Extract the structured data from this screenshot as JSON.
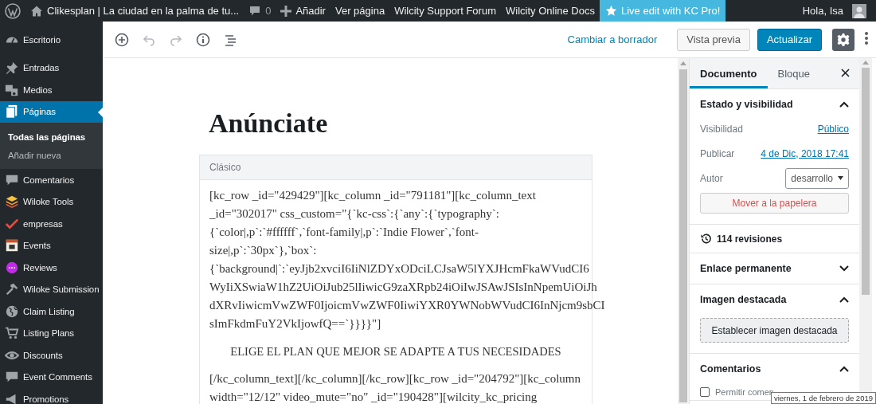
{
  "admin_bar": {
    "site_title": "Clikesplan | La ciudad en la palma de tu...",
    "comments_count": "0",
    "items": [
      {
        "label": "Añadir",
        "kind": "new"
      },
      {
        "label": "Ver página",
        "kind": "link"
      },
      {
        "label": "Wilcity Support Forum",
        "kind": "link"
      },
      {
        "label": "Wilcity Online Docs",
        "kind": "link"
      },
      {
        "label": "Live edit with KC Pro!",
        "kind": "highlight"
      }
    ],
    "greeting": "Hola, Isa"
  },
  "sidebar": {
    "items": [
      {
        "label": "Escritorio",
        "selected": false
      },
      {
        "label": "Entradas",
        "selected": false
      },
      {
        "label": "Medios",
        "selected": false
      },
      {
        "label": "Páginas",
        "selected": true,
        "children": [
          {
            "label": "Todas las páginas",
            "selected": true
          },
          {
            "label": "Añadir nueva",
            "selected": false
          }
        ]
      },
      {
        "label": "Comentarios",
        "selected": false
      },
      {
        "label": "Wiloke Tools",
        "selected": false
      },
      {
        "label": "empresas",
        "selected": false
      },
      {
        "label": "Events",
        "selected": false
      },
      {
        "label": "Reviews",
        "selected": false
      },
      {
        "label": "Wiloke Submission",
        "selected": false
      },
      {
        "label": "Claim Listing",
        "selected": false
      },
      {
        "label": "Listing Plans",
        "selected": false
      },
      {
        "label": "Discounts",
        "selected": false
      },
      {
        "label": "Event Comments",
        "selected": false
      },
      {
        "label": "Promotions",
        "selected": false
      }
    ]
  },
  "toolbar": {
    "switch_to_draft": "Cambiar a borrador",
    "preview": "Vista previa",
    "update": "Actualizar",
    "settings_selected": true
  },
  "document": {
    "title": "Anúnciate",
    "block_label": "Clásico",
    "paragraphs": [
      {
        "kind": "code",
        "lines": [
          "[kc_row _id=\"429429\"][kc_column _id=\"791181\"][kc_column_text",
          "_id=\"302017\" css_custom=\"{`kc-css`:{`any`:{`typography`:",
          "{`color|,p`:`#ffffff`,`font-family|,p`:`Indie Flower`,`font-",
          "size|,p`:`30px`},`box`:",
          "{`background|`:`eyJjb2xvciI6IiNlZDYxODciLCJsaW5lYXJHcmFkaWVudCI6",
          "WyIiXSwiaW1hZ2UiOiJub25lIiwicG9zaXRpb24iOiIwJSAwJSIsInNpemUiOiJh",
          "dXRvIiwicmVwZWF0IjoicmVwZWF0IiwiYXR0YWNobWVudCI6InNjcm9sbCI",
          "sImFkdmFuY2VkIjowfQ==`}}}}\"]"
        ]
      },
      {
        "kind": "heading",
        "lines": [
          "ELIGE EL PLAN QUE MEJOR SE ADAPTE A TUS NECESIDADES"
        ]
      },
      {
        "kind": "code",
        "lines": [
          "[/kc_column_text][/kc_column][/kc_row][kc_row _id=\"204792\"][kc_column",
          "width=\"12/12\" video_mute=\"no\" _id=\"190428\"][wilcity_kc_pricing"
        ]
      }
    ]
  },
  "panel": {
    "tabs": [
      {
        "label": "Documento",
        "selected": true
      },
      {
        "label": "Bloque",
        "selected": false
      }
    ],
    "sections": [
      {
        "kind": "panel",
        "title": "Estado y visibilidad",
        "expanded": true,
        "rows": [
          {
            "label": "Visibilidad",
            "value": "Público",
            "kind": "link"
          },
          {
            "label": "Publicar",
            "value": "4 de Dic, 2018 17:41",
            "kind": "link"
          },
          {
            "label": "Autor",
            "value": "desarrollo",
            "kind": "select"
          }
        ],
        "action": {
          "label": "Mover a la papelera",
          "kind": "danger"
        }
      },
      {
        "kind": "revisions",
        "title": "114 revisiones"
      },
      {
        "kind": "panel",
        "title": "Enlace permanente",
        "expanded": false
      },
      {
        "kind": "panel",
        "title": "Imagen destacada",
        "expanded": true,
        "action": {
          "label": "Establecer imagen destacada",
          "kind": "placeholder"
        }
      },
      {
        "kind": "panel",
        "title": "Comentarios",
        "expanded": true,
        "options": [
          {
            "label": "Permitir comen",
            "checked": false
          }
        ]
      }
    ]
  },
  "tooltip": {
    "text": "viernes, 1 de febrero de 2019"
  }
}
